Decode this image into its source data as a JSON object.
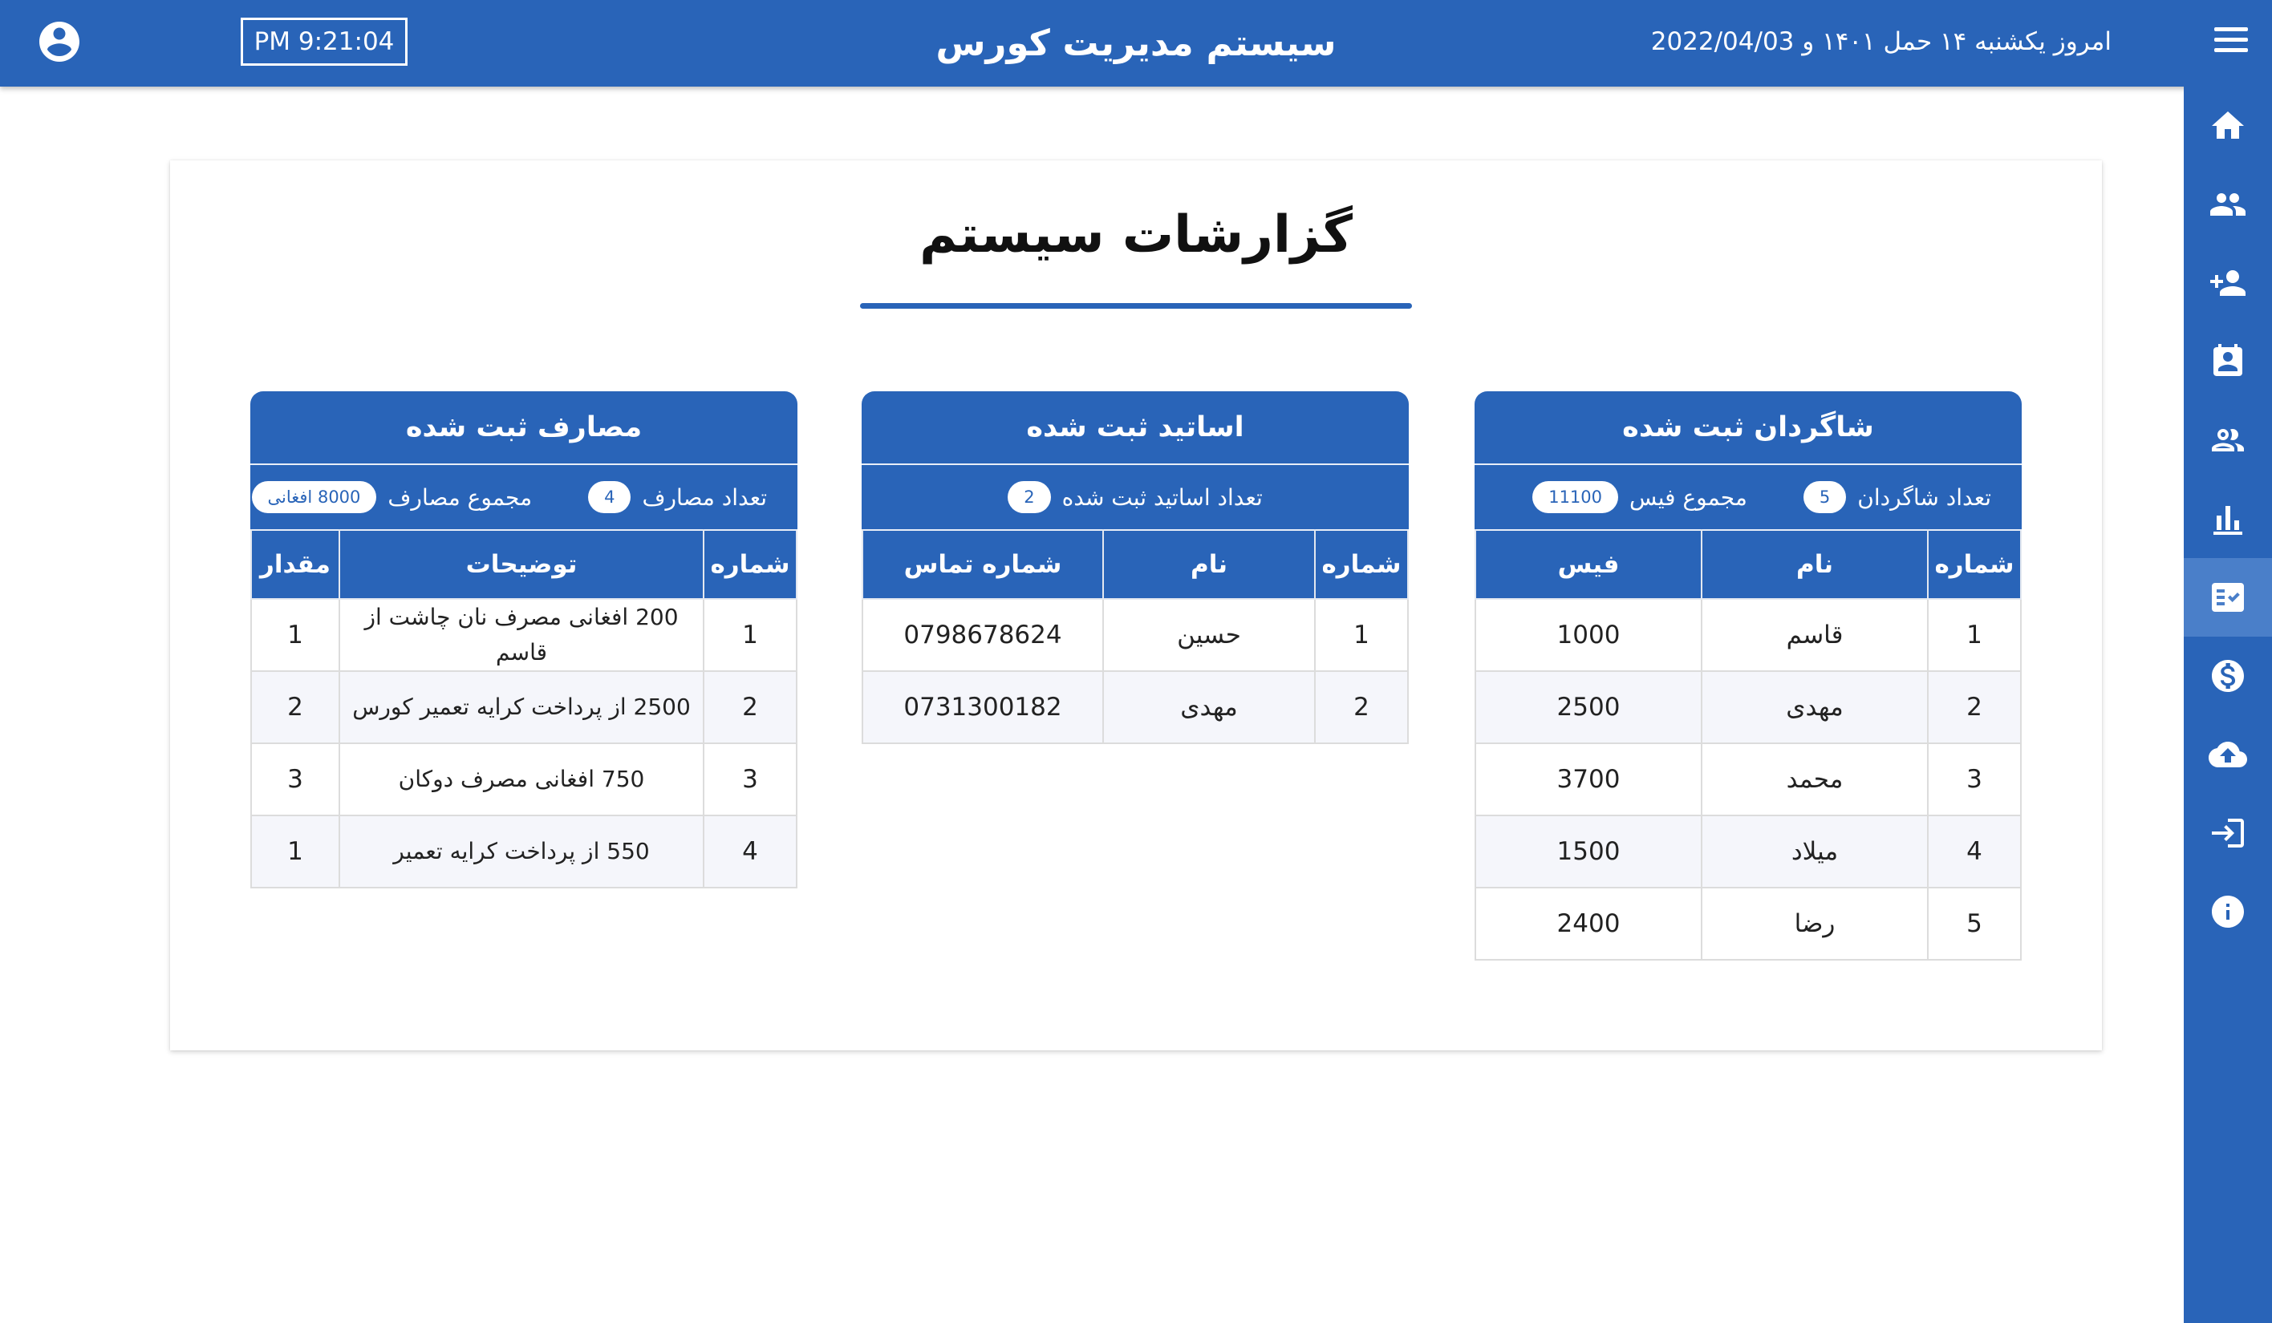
{
  "header": {
    "app_title": "سیستم مدیریت کورس",
    "clock": "PM 9:21:04",
    "date": "امروز یکشنبه ۱۴ حمل ۱۴۰۱ و 2022/04/03"
  },
  "sidebar": {
    "items": [
      {
        "icon": "home-icon"
      },
      {
        "icon": "people-icon"
      },
      {
        "icon": "person-add-icon"
      },
      {
        "icon": "contact-card-icon"
      },
      {
        "icon": "group-outline-icon"
      },
      {
        "icon": "bar-chart-icon"
      },
      {
        "icon": "fact-check-icon",
        "active": true
      },
      {
        "icon": "dollar-icon"
      },
      {
        "icon": "cloud-upload-icon"
      },
      {
        "icon": "login-icon"
      },
      {
        "icon": "info-icon"
      }
    ]
  },
  "page": {
    "title": "گزارشات سیستم"
  },
  "students": {
    "title": "شاگردان ثبت شده",
    "count_label": "تعداد شاگردان",
    "count": "5",
    "fee_label": "مجموع فیس",
    "fee_total": "11100",
    "headers": [
      "شماره",
      "نام",
      "فیس"
    ],
    "rows": [
      [
        "1",
        "قاسم",
        "1000"
      ],
      [
        "2",
        "مهدی",
        "2500"
      ],
      [
        "3",
        "محمد",
        "3700"
      ],
      [
        "4",
        "میلاد",
        "1500"
      ],
      [
        "5",
        "رضا",
        "2400"
      ]
    ]
  },
  "teachers": {
    "title": "اساتید ثبت شده",
    "count_label": "تعداد اساتید ثبت شده",
    "count": "2",
    "headers": [
      "شماره",
      "نام",
      "شماره تماس"
    ],
    "rows": [
      [
        "1",
        "حسین",
        "0798678624"
      ],
      [
        "2",
        "مهدی",
        "0731300182"
      ]
    ]
  },
  "expenses": {
    "title": "مصارف ثبت شده",
    "count_label": "تعداد مصارف",
    "count": "4",
    "total_label": "مجموع مصارف",
    "total": "8000 افغانی",
    "headers": [
      "شماره",
      "توضیحات",
      "مقدار"
    ],
    "rows": [
      [
        "1",
        "200 افغانی مصرف نان چاشت از قاسم",
        "1"
      ],
      [
        "2",
        "2500 از پرداخت کرایه تعمیر کورس",
        "2"
      ],
      [
        "3",
        "750 افغانی مصرف دوکان",
        "3"
      ],
      [
        "4",
        "550 از پرداخت کرایه تعمیر",
        "1"
      ]
    ]
  },
  "colors": {
    "primary": "#2964b8",
    "sidebar_active": "#4a7fc9",
    "row_alt": "#f5f6fb"
  }
}
